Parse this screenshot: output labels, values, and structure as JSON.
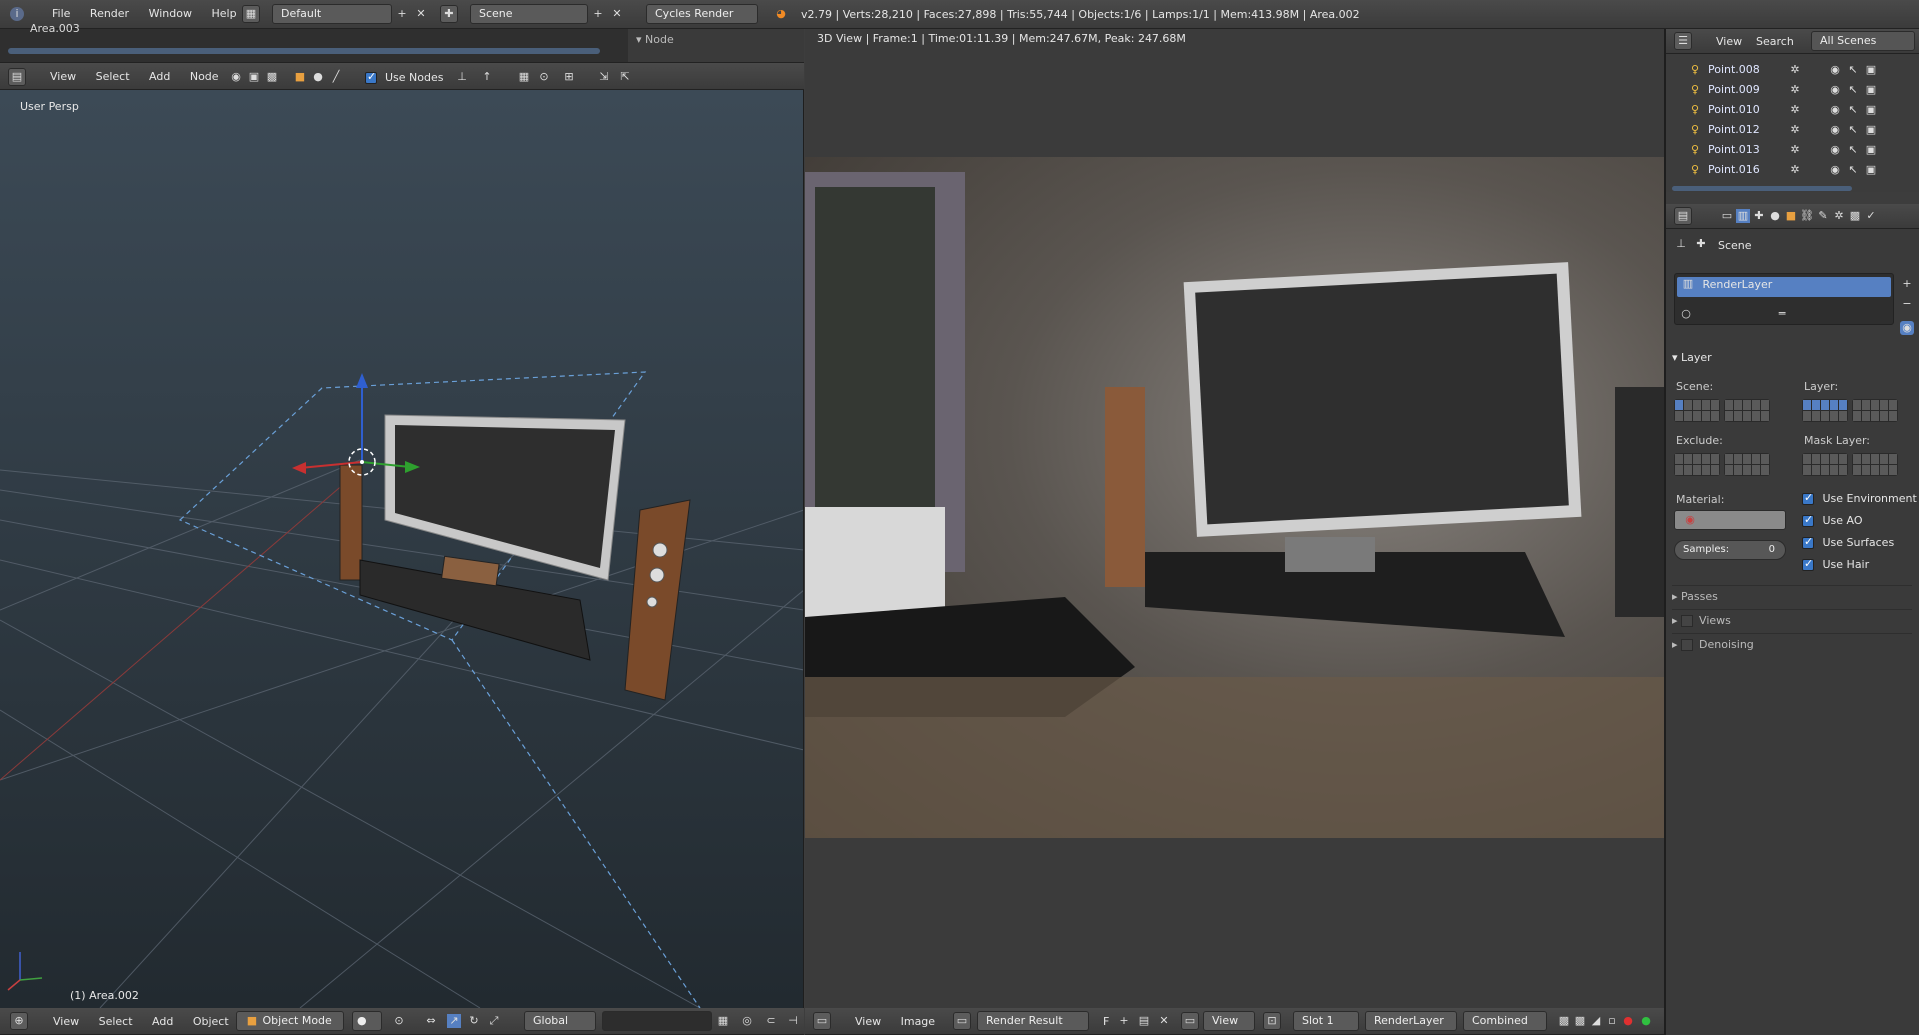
{
  "topbar": {
    "menus": [
      "File",
      "Render",
      "Window",
      "Help"
    ],
    "screen_layout": "Default",
    "scene": "Scene",
    "render_engine": "Cycles Render",
    "stats": "v2.79 | Verts:28,210 | Faces:27,898 | Tris:55,744 | Objects:1/6 | Lamps:1/1 | Mem:413.98M | Area.002"
  },
  "node_editor": {
    "area_label": "Area.003",
    "node_panel_label": "Node",
    "menus": [
      "View",
      "Select",
      "Add",
      "Node"
    ],
    "use_nodes_label": "Use Nodes"
  },
  "viewport": {
    "view_label": "User Persp",
    "selection_label": "(1) Area.002",
    "menus": [
      "View",
      "Select",
      "Add",
      "Object"
    ],
    "mode": "Object Mode",
    "orientation": "Global"
  },
  "render_view": {
    "status": "3D View | Frame:1 | Time:01:11.39 | Mem:247.67M, Peak: 247.68M",
    "menus": [
      "View",
      "Image"
    ],
    "image_name": "Render Result",
    "image_flag": "F",
    "view_menu": "View",
    "slot": "Slot 1",
    "render_layer": "RenderLayer",
    "pass": "Combined"
  },
  "outliner": {
    "menus": [
      "View",
      "Search"
    ],
    "filter": "All Scenes",
    "items": [
      "Point.008",
      "Point.009",
      "Point.010",
      "Point.012",
      "Point.013",
      "Point.016"
    ]
  },
  "properties": {
    "breadcrumb": "Scene",
    "render_layer": "RenderLayer",
    "layer_section": "Layer",
    "scene_label": "Scene:",
    "layer_label": "Layer:",
    "exclude_label": "Exclude:",
    "mask_layer_label": "Mask Layer:",
    "material_label": "Material:",
    "samples_label": "Samples:",
    "samples_value": "0",
    "options": [
      "Use Environment",
      "Use AO",
      "Use Surfaces",
      "Use Hair"
    ],
    "collapsed_sections": [
      "Passes",
      "Views",
      "Denoising"
    ]
  },
  "colors": {
    "accent": "#5680c2",
    "header": "#454545",
    "panel": "#3a3a3a",
    "viewport_top": "#3c4a56",
    "viewport_bottom": "#222a30"
  }
}
